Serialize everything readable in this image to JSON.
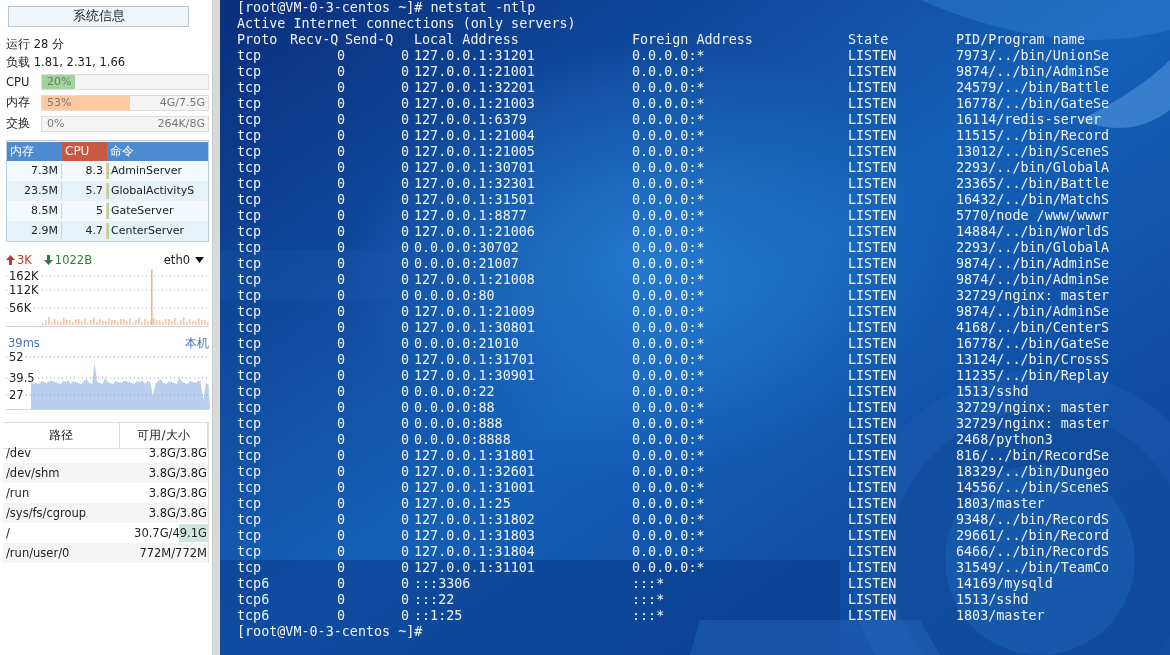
{
  "sidebar": {
    "title": "系统信息",
    "uptime": "运行 28 分",
    "load": "负载 1.81, 2.31, 1.66",
    "meters": [
      {
        "label": "CPU",
        "percent": "20%",
        "level": 0.2,
        "color": "#9fd49a"
      },
      {
        "label": "内存",
        "percent": "53%",
        "amount": "4G/7.5G",
        "level": 0.53,
        "color": "#fdc9a0"
      },
      {
        "label": "交换",
        "percent": "0%",
        "amount": "264K/8G"
      }
    ],
    "process_table": {
      "columns": [
        {
          "label": "内存",
          "selected": false
        },
        {
          "label": "CPU",
          "selected": true
        },
        {
          "label": "命令",
          "selected": false
        }
      ],
      "rows": [
        [
          "7.3M",
          "8.3",
          "AdminServer"
        ],
        [
          "23.5M",
          "5.7",
          "GlobalActivityS"
        ],
        [
          "8.5M",
          "5",
          "GateServer"
        ],
        [
          "2.9M",
          "4.7",
          "CenterServer"
        ]
      ]
    },
    "network": {
      "upload": "3K",
      "download": "1022B",
      "interface": "eth0",
      "ticks": [
        "162K",
        "112K",
        "56K"
      ]
    },
    "ping": {
      "latency": "39ms",
      "target": "本机",
      "ticks": [
        "52",
        "39.5",
        "27"
      ]
    },
    "disk_table": {
      "columns": [
        "路径",
        "可用/大小"
      ],
      "rows": [
        {
          "path": "/dev",
          "size": "3.8G/3.8G"
        },
        {
          "path": "/dev/shm",
          "size": "3.8G/3.8G"
        },
        {
          "path": "/run",
          "size": "3.8G/3.8G"
        },
        {
          "path": "/sys/fs/cgroup",
          "size": "3.8G/3.8G"
        },
        {
          "path": "/",
          "size": "30.7G/49.1G",
          "level": 0.33
        },
        {
          "path": "/run/user/0",
          "size": "772M/772M"
        }
      ]
    }
  },
  "terminal": {
    "command_line": "[root@VM-0-3-centos ~]# netstat -ntlp",
    "heading": "Active Internet connections (only servers)",
    "columns": [
      "Proto",
      "Recv-Q",
      "Send-Q",
      "Local Address",
      "Foreign Address",
      "State",
      "PID/Program name"
    ],
    "rows": [
      [
        "tcp",
        "0",
        "0",
        "127.0.0.1:31201",
        "0.0.0.0:*",
        "LISTEN",
        "7973/../bin/UnionSe"
      ],
      [
        "tcp",
        "0",
        "0",
        "127.0.0.1:21001",
        "0.0.0.0:*",
        "LISTEN",
        "9874/../bin/AdminSe"
      ],
      [
        "tcp",
        "0",
        "0",
        "127.0.0.1:32201",
        "0.0.0.0:*",
        "LISTEN",
        "24579/../bin/Battle"
      ],
      [
        "tcp",
        "0",
        "0",
        "127.0.0.1:21003",
        "0.0.0.0:*",
        "LISTEN",
        "16778/../bin/GateSe"
      ],
      [
        "tcp",
        "0",
        "0",
        "127.0.0.1:6379",
        "0.0.0.0:*",
        "LISTEN",
        "16114/redis-server"
      ],
      [
        "tcp",
        "0",
        "0",
        "127.0.0.1:21004",
        "0.0.0.0:*",
        "LISTEN",
        "11515/../bin/Record"
      ],
      [
        "tcp",
        "0",
        "0",
        "127.0.0.1:21005",
        "0.0.0.0:*",
        "LISTEN",
        "13012/../bin/SceneS"
      ],
      [
        "tcp",
        "0",
        "0",
        "127.0.0.1:30701",
        "0.0.0.0:*",
        "LISTEN",
        "2293/../bin/GlobalA"
      ],
      [
        "tcp",
        "0",
        "0",
        "127.0.0.1:32301",
        "0.0.0.0:*",
        "LISTEN",
        "23365/../bin/Battle"
      ],
      [
        "tcp",
        "0",
        "0",
        "127.0.0.1:31501",
        "0.0.0.0:*",
        "LISTEN",
        "16432/../bin/MatchS"
      ],
      [
        "tcp",
        "0",
        "0",
        "127.0.0.1:8877",
        "0.0.0.0:*",
        "LISTEN",
        "5770/node /www/wwwr"
      ],
      [
        "tcp",
        "0",
        "0",
        "127.0.0.1:21006",
        "0.0.0.0:*",
        "LISTEN",
        "14884/../bin/WorldS"
      ],
      [
        "tcp",
        "0",
        "0",
        "0.0.0.0:30702",
        "0.0.0.0:*",
        "LISTEN",
        "2293/../bin/GlobalA"
      ],
      [
        "tcp",
        "0",
        "0",
        "0.0.0.0:21007",
        "0.0.0.0:*",
        "LISTEN",
        "9874/../bin/AdminSe"
      ],
      [
        "tcp",
        "0",
        "0",
        "127.0.0.1:21008",
        "0.0.0.0:*",
        "LISTEN",
        "9874/../bin/AdminSe"
      ],
      [
        "tcp",
        "0",
        "0",
        "0.0.0.0:80",
        "0.0.0.0:*",
        "LISTEN",
        "32729/nginx: master"
      ],
      [
        "tcp",
        "0",
        "0",
        "127.0.0.1:21009",
        "0.0.0.0:*",
        "LISTEN",
        "9874/../bin/AdminSe"
      ],
      [
        "tcp",
        "0",
        "0",
        "127.0.0.1:30801",
        "0.0.0.0:*",
        "LISTEN",
        "4168/../bin/CenterS"
      ],
      [
        "tcp",
        "0",
        "0",
        "0.0.0.0:21010",
        "0.0.0.0:*",
        "LISTEN",
        "16778/../bin/GateSe"
      ],
      [
        "tcp",
        "0",
        "0",
        "127.0.0.1:31701",
        "0.0.0.0:*",
        "LISTEN",
        "13124/../bin/CrossS"
      ],
      [
        "tcp",
        "0",
        "0",
        "127.0.0.1:30901",
        "0.0.0.0:*",
        "LISTEN",
        "11235/../bin/Replay"
      ],
      [
        "tcp",
        "0",
        "0",
        "0.0.0.0:22",
        "0.0.0.0:*",
        "LISTEN",
        "1513/sshd"
      ],
      [
        "tcp",
        "0",
        "0",
        "0.0.0.0:88",
        "0.0.0.0:*",
        "LISTEN",
        "32729/nginx: master"
      ],
      [
        "tcp",
        "0",
        "0",
        "0.0.0.0:888",
        "0.0.0.0:*",
        "LISTEN",
        "32729/nginx: master"
      ],
      [
        "tcp",
        "0",
        "0",
        "0.0.0.0:8888",
        "0.0.0.0:*",
        "LISTEN",
        "2468/python3"
      ],
      [
        "tcp",
        "0",
        "0",
        "127.0.0.1:31801",
        "0.0.0.0:*",
        "LISTEN",
        "816/../bin/RecordSe"
      ],
      [
        "tcp",
        "0",
        "0",
        "127.0.0.1:32601",
        "0.0.0.0:*",
        "LISTEN",
        "18329/../bin/Dungeo"
      ],
      [
        "tcp",
        "0",
        "0",
        "127.0.0.1:31001",
        "0.0.0.0:*",
        "LISTEN",
        "14556/../bin/SceneS"
      ],
      [
        "tcp",
        "0",
        "0",
        "127.0.0.1:25",
        "0.0.0.0:*",
        "LISTEN",
        "1803/master"
      ],
      [
        "tcp",
        "0",
        "0",
        "127.0.0.1:31802",
        "0.0.0.0:*",
        "LISTEN",
        "9348/../bin/RecordS"
      ],
      [
        "tcp",
        "0",
        "0",
        "127.0.0.1:31803",
        "0.0.0.0:*",
        "LISTEN",
        "29661/../bin/Record"
      ],
      [
        "tcp",
        "0",
        "0",
        "127.0.0.1:31804",
        "0.0.0.0:*",
        "LISTEN",
        "6466/../bin/RecordS"
      ],
      [
        "tcp",
        "0",
        "0",
        "127.0.0.1:31101",
        "0.0.0.0:*",
        "LISTEN",
        "31549/../bin/TeamCo"
      ],
      [
        "tcp6",
        "0",
        "0",
        ":::3306",
        ":::*",
        "LISTEN",
        "14169/mysqld"
      ],
      [
        "tcp6",
        "0",
        "0",
        ":::22",
        ":::*",
        "LISTEN",
        "1513/sshd"
      ],
      [
        "tcp6",
        "0",
        "0",
        "::1:25",
        ":::*",
        "LISTEN",
        "1803/master"
      ]
    ],
    "prompt": "[root@VM-0-3-centos ~]#"
  }
}
